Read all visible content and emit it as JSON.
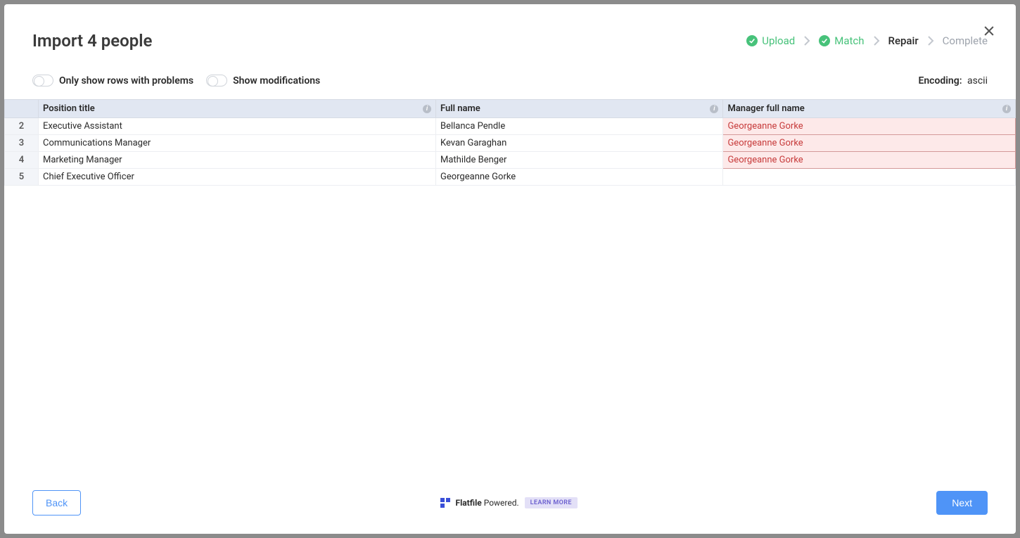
{
  "title": "Import 4 people",
  "progress": {
    "upload": "Upload",
    "match": "Match",
    "repair": "Repair",
    "complete": "Complete"
  },
  "toolbar": {
    "only_problems": "Only show rows with problems",
    "show_modifications": "Show modifications",
    "encoding_label": "Encoding:",
    "encoding_value": "ascii"
  },
  "table": {
    "headers": {
      "position_title": "Position title",
      "full_name": "Full name",
      "manager_full_name": "Manager full name"
    },
    "rows": [
      {
        "num": "2",
        "position": "Executive Assistant",
        "name": "Bellanca Pendle",
        "manager": "Georgeanne Gorke",
        "manager_error": true
      },
      {
        "num": "3",
        "position": "Communications Manager",
        "name": "Kevan Garaghan",
        "manager": "Georgeanne Gorke",
        "manager_error": true
      },
      {
        "num": "4",
        "position": "Marketing Manager",
        "name": "Mathilde Benger",
        "manager": "Georgeanne Gorke",
        "manager_error": true
      },
      {
        "num": "5",
        "position": "Chief Executive Officer",
        "name": "Georgeanne Gorke",
        "manager": "",
        "manager_error": false
      }
    ]
  },
  "footer": {
    "back": "Back",
    "next": "Next",
    "powered": "Flatfile",
    "powered_suffix": "Powered.",
    "learn_more": "LEARN MORE"
  }
}
